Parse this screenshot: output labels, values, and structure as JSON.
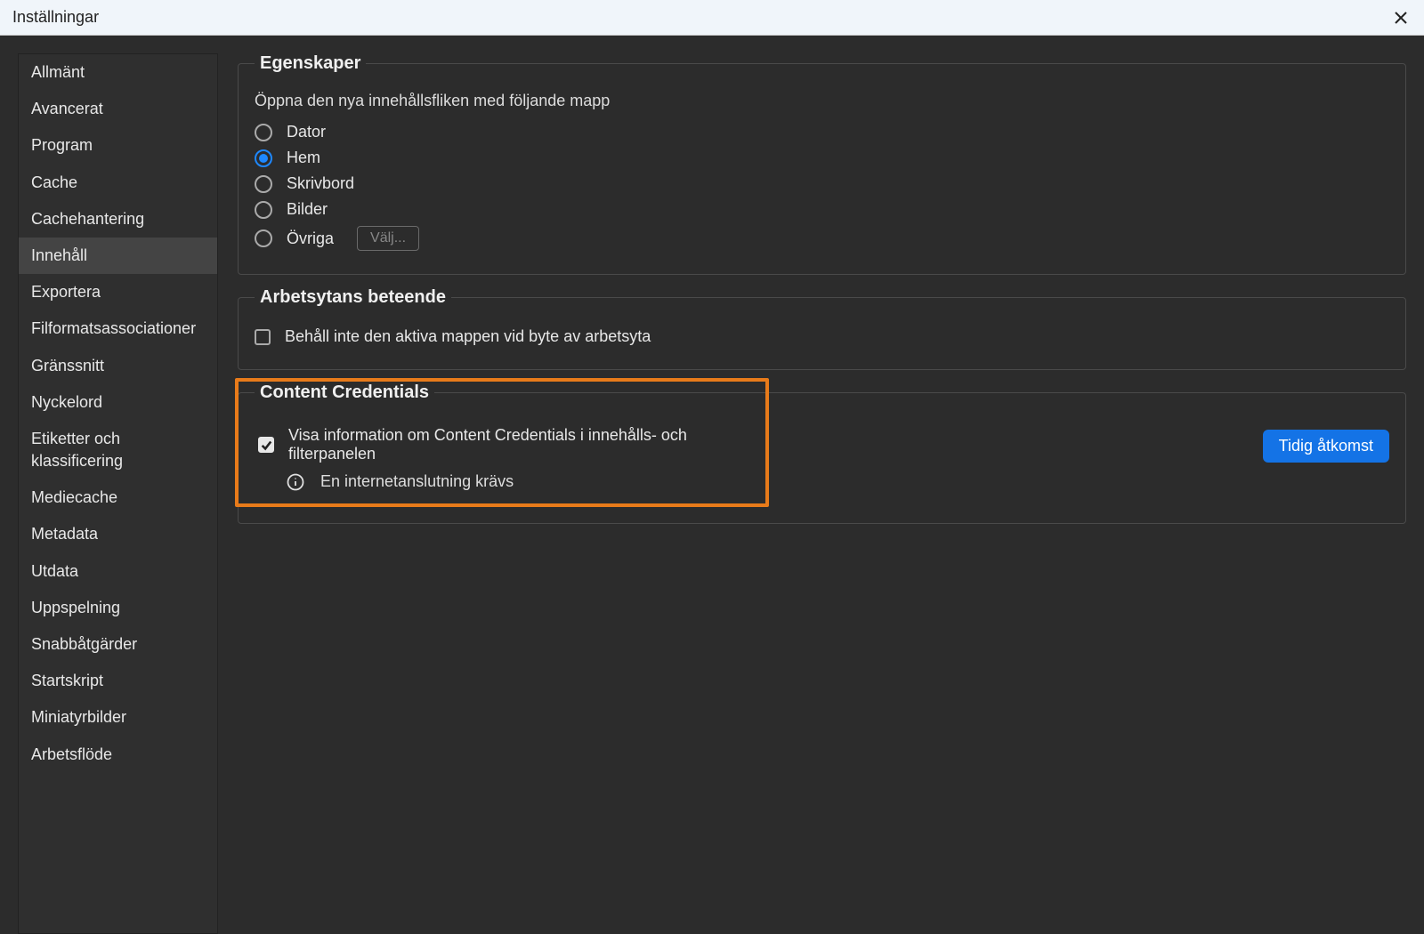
{
  "window": {
    "title": "Inställningar"
  },
  "sidebar": {
    "items": [
      "Allmänt",
      "Avancerat",
      "Program",
      "Cache",
      "Cachehantering",
      "Innehåll",
      "Exportera",
      "Filformatsassociationer",
      "Gränssnitt",
      "Nyckelord",
      "Etiketter och klassificering",
      "Mediecache",
      "Metadata",
      "Utdata",
      "Uppspelning",
      "Snabbåtgärder",
      "Startskript",
      "Miniatyrbilder",
      "Arbetsflöde"
    ],
    "selected_index": 5
  },
  "properties": {
    "legend": "Egenskaper",
    "description": "Öppna den nya innehållsfliken med följande mapp",
    "radios": [
      "Dator",
      "Hem",
      "Skrivbord",
      "Bilder",
      "Övriga"
    ],
    "selected_index": 1,
    "choose_button": "Välj..."
  },
  "workspace": {
    "legend": "Arbetsytans beteende",
    "checkbox_label": "Behåll inte den aktiva mappen vid byte av arbetsyta",
    "checked": false
  },
  "content_credentials": {
    "legend": "Content Credentials",
    "checkbox_label": "Visa information om Content Credentials i innehålls- och filterpanelen",
    "checked": true,
    "info_text": "En internetanslutning krävs",
    "badge_button": "Tidig åtkomst"
  }
}
